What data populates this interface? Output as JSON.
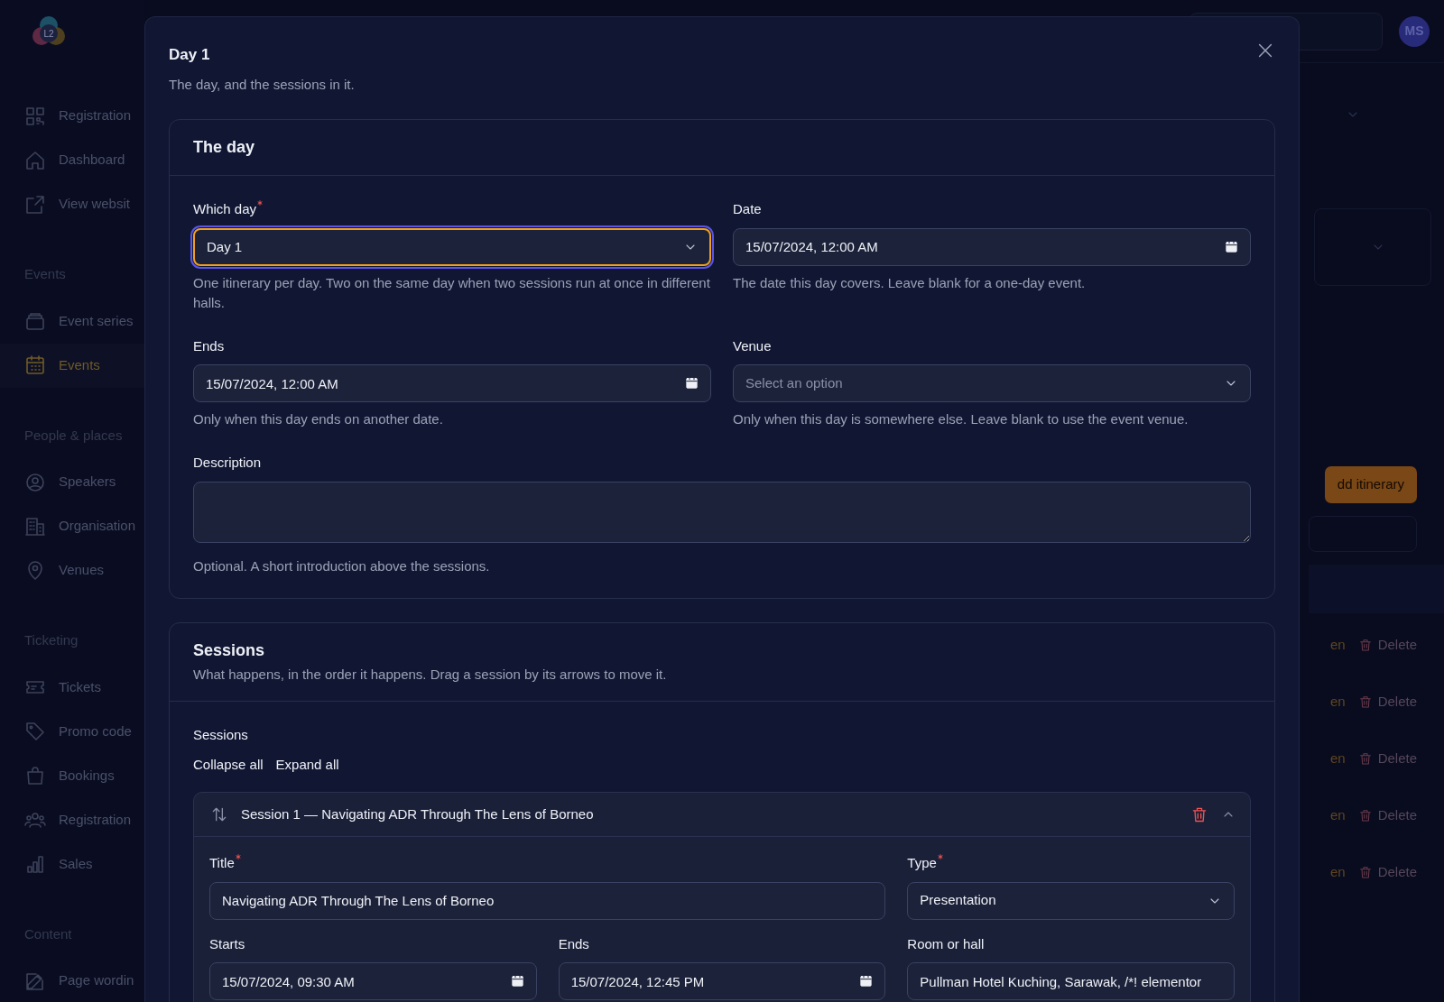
{
  "app": {
    "logo_text": "L2",
    "avatar": "MS"
  },
  "sidebar": {
    "sections": [
      {
        "items": [
          {
            "label": "Registration",
            "selected": false
          },
          {
            "label": "Dashboard",
            "selected": false
          },
          {
            "label": "View websit",
            "selected": false
          }
        ]
      },
      {
        "heading": "Events",
        "items": [
          {
            "label": "Event series",
            "selected": false
          },
          {
            "label": "Events",
            "selected": true
          }
        ]
      },
      {
        "heading": "People & places",
        "items": [
          {
            "label": "Speakers",
            "selected": false
          },
          {
            "label": "Organisation",
            "selected": false
          },
          {
            "label": "Venues",
            "selected": false
          }
        ]
      },
      {
        "heading": "Ticketing",
        "items": [
          {
            "label": "Tickets",
            "selected": false
          },
          {
            "label": "Promo code",
            "selected": false
          },
          {
            "label": "Bookings",
            "selected": false
          },
          {
            "label": "Registration",
            "selected": false
          },
          {
            "label": "Sales",
            "selected": false
          }
        ]
      },
      {
        "heading": "Content",
        "items": [
          {
            "label": "Page wordin",
            "selected": false
          }
        ]
      }
    ]
  },
  "background": {
    "add_button": "dd itinerary",
    "rows": [
      {
        "open": "en",
        "delete": "Delete"
      },
      {
        "open": "en",
        "delete": "Delete"
      },
      {
        "open": "en",
        "delete": "Delete"
      },
      {
        "open": "en",
        "delete": "Delete"
      },
      {
        "open": "en",
        "delete": "Delete"
      }
    ]
  },
  "modal": {
    "title": "Day 1",
    "subtitle": "The day, and the sessions in it.",
    "day_card": {
      "title": "The day",
      "fields": [
        {
          "kind": "select",
          "label": "Which day",
          "required": true,
          "focused": true,
          "value": "Day 1",
          "help": "One itinerary per day. Two on the same day when two sessions run at once in different halls."
        },
        {
          "kind": "datetime",
          "label": "Date",
          "value": "15/07/2024, 12:00 AM",
          "help": "The date this day covers. Leave blank for a one-day event."
        },
        {
          "kind": "datetime",
          "label": "Ends",
          "value": "15/07/2024, 12:00 AM",
          "help": "Only when this day ends on another date."
        },
        {
          "kind": "select",
          "label": "Venue",
          "placeholder": "Select an option",
          "help": "Only when this day is somewhere else. Leave blank to use the event venue."
        },
        {
          "kind": "textarea",
          "label": "Description",
          "help": "Optional. A short introduction above the sessions."
        }
      ]
    },
    "sessions_card": {
      "title": "Sessions",
      "subtitle": "What happens, in the order it happens. Drag a session by its arrows to move it.",
      "list_label": "Sessions",
      "collapse_all": "Collapse all",
      "expand_all": "Expand all",
      "sessions": [
        {
          "heading": "Session 1 — Navigating ADR Through The Lens of Borneo",
          "expanded": true,
          "fields": [
            {
              "kind": "text",
              "label": "Title",
              "required": true,
              "value": "Navigating ADR Through The Lens of Borneo"
            },
            {
              "kind": "select",
              "label": "Type",
              "required": true,
              "value": "Presentation"
            },
            {
              "kind": "datetime",
              "label": "Starts",
              "value": "15/07/2024, 09:30 AM"
            },
            {
              "kind": "datetime",
              "label": "Ends",
              "value": "15/07/2024, 12:45 PM"
            },
            {
              "kind": "text",
              "label": "Room or hall",
              "value": "Pullman Hotel Kuching, Sarawak, /*! elementor"
            }
          ]
        }
      ]
    }
  }
}
